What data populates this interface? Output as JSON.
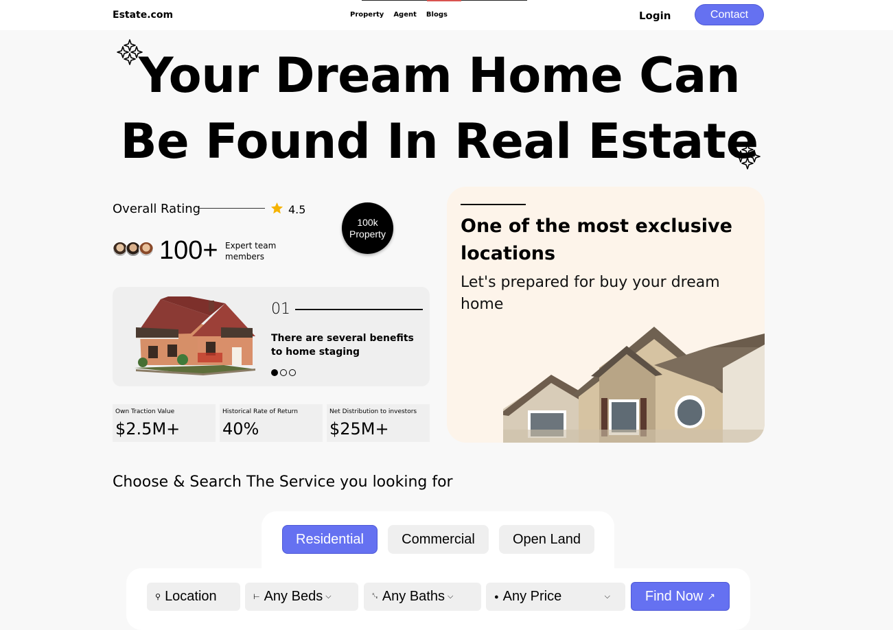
{
  "header": {
    "logo": "Estate.com",
    "nav": [
      "Property",
      "Agent",
      "Blogs"
    ],
    "login": "Login",
    "contact": "Contact"
  },
  "hero": {
    "title_line1": "Your Dream Home Can",
    "title_line2": "Be Found In Real Estate"
  },
  "rating": {
    "label": "Overall Rating",
    "value": "4.5"
  },
  "team": {
    "count": "100+",
    "label": "Expert team members"
  },
  "badge": {
    "line1": "100k",
    "line2": "Property"
  },
  "benefit": {
    "number": "01",
    "text": "There are several benefits to home staging",
    "active_slide": 1,
    "total_slides": 3
  },
  "stats": [
    {
      "label": "Own Traction Value",
      "value": "$2.5M+"
    },
    {
      "label": "Historical Rate of Return",
      "value": "40%"
    },
    {
      "label": "Net Distribution to investors",
      "value": "$25M+"
    }
  ],
  "promo": {
    "title": "One of the most exclusive locations",
    "subtitle": "Let's prepared for buy your dream home"
  },
  "search_section": {
    "heading": "Choose & Search The Service you looking for",
    "tabs": [
      "Residential",
      "Commercial",
      "Open Land"
    ],
    "active_tab": "Residential",
    "filters": {
      "location": "Location",
      "beds": "Any Beds",
      "baths": "Any Baths",
      "price": "Any Price"
    },
    "find_button": "Find Now"
  },
  "colors": {
    "accent": "#6571f1",
    "promo_bg": "#fdf4ea",
    "card_bg": "#efefef",
    "star": "#f5b301"
  },
  "icons": {
    "location": "map-pin-icon",
    "beds": "bed-icon",
    "baths": "bathtub-icon",
    "price": "price-tag-icon",
    "arrow": "arrow-up-right-icon"
  }
}
